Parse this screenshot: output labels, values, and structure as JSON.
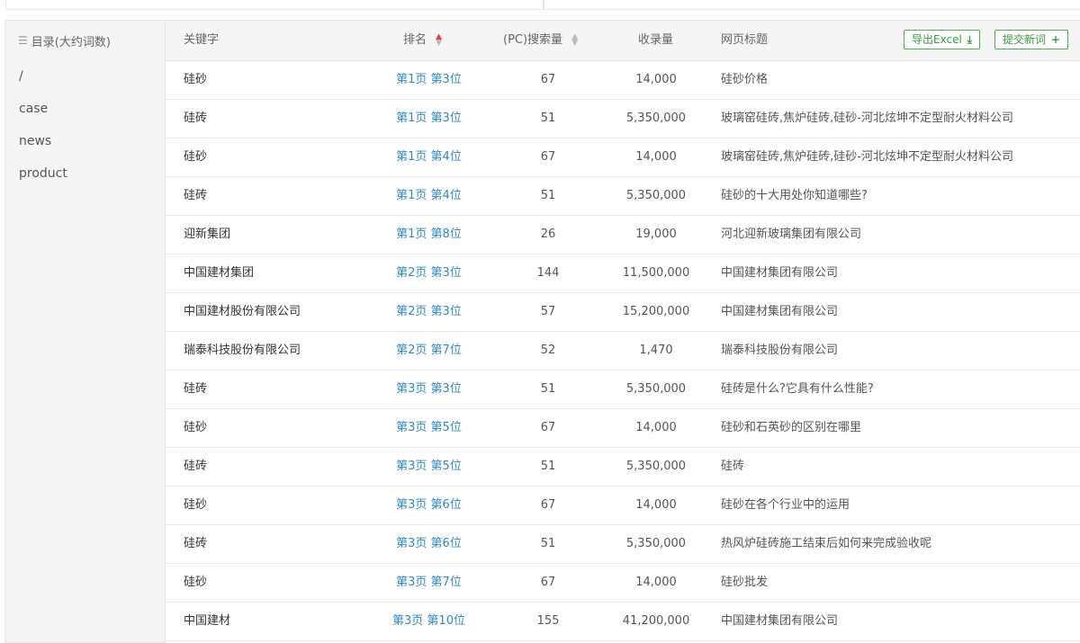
{
  "sidebar": {
    "title": "目录(大约词数)",
    "items": [
      "/",
      "case",
      "news",
      "product"
    ]
  },
  "toolbar": {
    "export_label": "导出Excel",
    "submit_label": "提交新词"
  },
  "table": {
    "headers": {
      "keyword": "关键字",
      "rank": "排名",
      "search": "(PC)搜索量",
      "index": "收录量",
      "title": "网页标题"
    },
    "rows": [
      {
        "keyword": "硅砂",
        "rank": "第1页 第3位",
        "search": "67",
        "index": "14,000",
        "title": "硅砂价格"
      },
      {
        "keyword": "硅砖",
        "rank": "第1页 第3位",
        "search": "51",
        "index": "5,350,000",
        "title": "玻璃窑硅砖,焦炉硅砖,硅砂-河北炫坤不定型耐火材料公司"
      },
      {
        "keyword": "硅砂",
        "rank": "第1页 第4位",
        "search": "67",
        "index": "14,000",
        "title": "玻璃窑硅砖,焦炉硅砖,硅砂-河北炫坤不定型耐火材料公司"
      },
      {
        "keyword": "硅砖",
        "rank": "第1页 第4位",
        "search": "51",
        "index": "5,350,000",
        "title": "硅砂的十大用处你知道哪些?"
      },
      {
        "keyword": "迎新集团",
        "rank": "第1页 第8位",
        "search": "26",
        "index": "19,000",
        "title": "河北迎新玻璃集团有限公司"
      },
      {
        "keyword": "中国建材集团",
        "rank": "第2页 第3位",
        "search": "144",
        "index": "11,500,000",
        "title": "中国建材集团有限公司"
      },
      {
        "keyword": "中国建材股份有限公司",
        "rank": "第2页 第3位",
        "search": "57",
        "index": "15,200,000",
        "title": "中国建材集团有限公司"
      },
      {
        "keyword": "瑞泰科技股份有限公司",
        "rank": "第2页 第7位",
        "search": "52",
        "index": "1,470",
        "title": "瑞泰科技股份有限公司"
      },
      {
        "keyword": "硅砖",
        "rank": "第3页 第3位",
        "search": "51",
        "index": "5,350,000",
        "title": "硅砖是什么?它具有什么性能?"
      },
      {
        "keyword": "硅砂",
        "rank": "第3页 第5位",
        "search": "67",
        "index": "14,000",
        "title": "硅砂和石英砂的区别在哪里"
      },
      {
        "keyword": "硅砖",
        "rank": "第3页 第5位",
        "search": "51",
        "index": "5,350,000",
        "title": "硅砖"
      },
      {
        "keyword": "硅砂",
        "rank": "第3页 第6位",
        "search": "67",
        "index": "14,000",
        "title": "硅砂在各个行业中的运用"
      },
      {
        "keyword": "硅砖",
        "rank": "第3页 第6位",
        "search": "51",
        "index": "5,350,000",
        "title": "热风炉硅砖施工结束后如何来完成验收呢"
      },
      {
        "keyword": "硅砂",
        "rank": "第3页 第7位",
        "search": "67",
        "index": "14,000",
        "title": "硅砂批发"
      },
      {
        "keyword": "中国建材",
        "rank": "第3页 第10位",
        "search": "155",
        "index": "41,200,000",
        "title": "中国建材集团有限公司"
      }
    ]
  },
  "colors": {
    "link": "#2b8ac6",
    "accent_green": "#4caf50",
    "sort_active": "#e03c3c"
  },
  "icons": {
    "sidebar": "list-icon",
    "export": "download-icon",
    "submit": "plus-icon"
  }
}
